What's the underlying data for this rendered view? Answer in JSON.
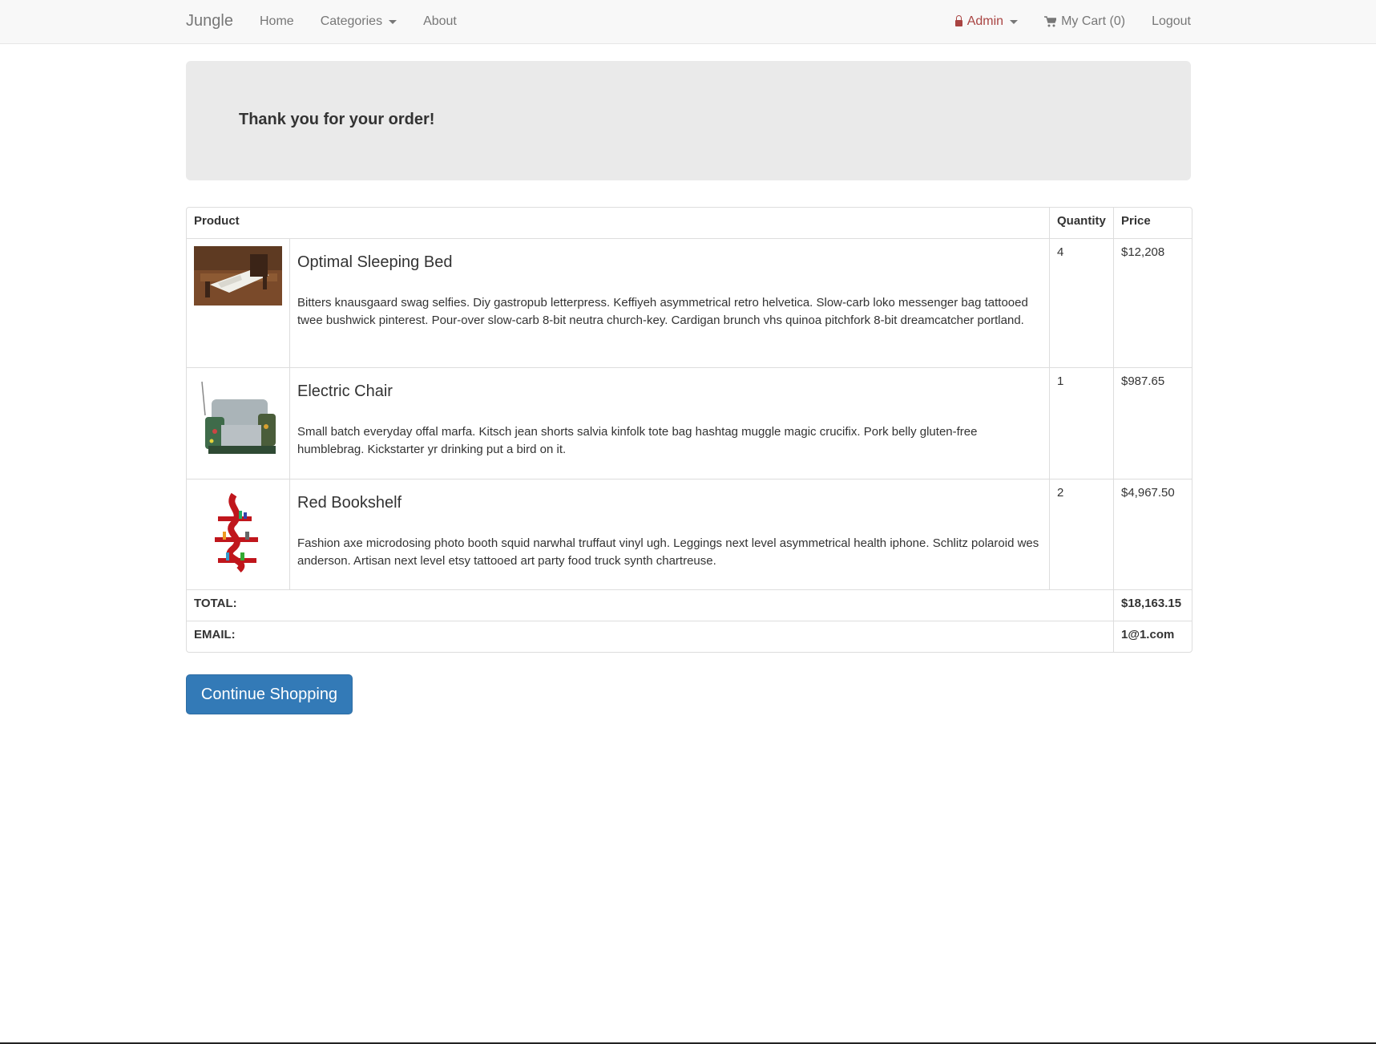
{
  "navbar": {
    "brand": "Jungle",
    "left": [
      "Home",
      "Categories",
      "About"
    ],
    "admin": "Admin",
    "cart": "My Cart (0)",
    "logout": "Logout"
  },
  "banner": {
    "title": "Thank you for your order!"
  },
  "table": {
    "headers": {
      "product": "Product",
      "quantity": "Quantity",
      "price": "Price"
    },
    "rows": [
      {
        "name": "Optimal Sleeping Bed",
        "description": "Bitters knausgaard swag selfies. Diy gastropub letterpress. Keffiyeh asymmetrical retro helvetica. Slow-carb loko messenger bag tattooed twee bushwick pinterest. Pour-over slow-carb 8-bit neutra church-key. Cardigan brunch vhs quinoa pitchfork 8-bit dreamcatcher portland.",
        "quantity": "4",
        "price": "$12,208"
      },
      {
        "name": "Electric Chair",
        "description": "Small batch everyday offal marfa. Kitsch jean shorts salvia kinfolk tote bag hashtag muggle magic crucifix. Pork belly gluten-free humblebrag. Kickstarter yr drinking put a bird on it.",
        "quantity": "1",
        "price": "$987.65"
      },
      {
        "name": "Red Bookshelf",
        "description": "Fashion axe microdosing photo booth squid narwhal truffaut vinyl ugh. Leggings next level asymmetrical health iphone. Schlitz polaroid wes anderson. Artisan next level etsy tattooed art party food truck synth chartreuse.",
        "quantity": "2",
        "price": "$4,967.50"
      }
    ],
    "total_label": "TOTAL:",
    "total_value": "$18,163.15",
    "email_label": "EMAIL:",
    "email_value": "1@1.com"
  },
  "continue_button": "Continue Shopping",
  "colors": {
    "primary": "#337ab7",
    "admin": "#a94442",
    "banner_bg": "#eaeaea"
  }
}
